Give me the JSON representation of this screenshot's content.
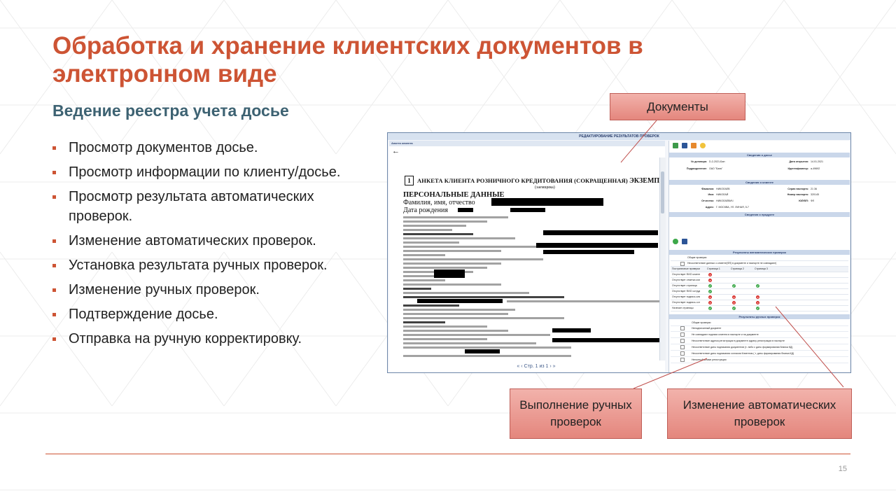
{
  "slide": {
    "title": "Обработка и хранение клиентских документов в электронном виде",
    "subtitle": "Ведение реестра учета досье",
    "bullets": [
      "Просмотр документов досье.",
      "Просмотр информации по клиенту/досье.",
      "Просмотр результата автоматических проверок.",
      "Изменение автоматических проверок.",
      "Установка результата ручных проверок.",
      "Изменение ручных проверок.",
      "Подтверждение досье.",
      "Отправка на ручную корректировку."
    ],
    "page_number": "15",
    "accent_color": "#cd5434"
  },
  "callouts": {
    "documents": "Документы",
    "manual": "Выполнение ручных проверок",
    "auto": "Изменение автоматических проверок"
  },
  "screenshot": {
    "window_title": "РЕДАКТИРОВАНИЕ РЕЗУЛЬТАТОВ ПРОВЕРОК",
    "doc_pane_title": "Анкета клиента",
    "back_icon": "arrow-left-icon",
    "doc": {
      "page_box": "1",
      "heading": "АНКЕТА КЛИЕНТА РОЗНИЧНОГО КРЕДИТОВАНИЯ (СОКРАЩЕННАЯ)",
      "heading_tail": "ЭКЗЕМПЛЯ",
      "subheading": "(заемщика)",
      "section": "ПЕРСОНАЛЬНЫЕ ДАННЫЕ",
      "fio_label": "Фамилия, имя, отчество",
      "birth_label": "Дата рождения"
    },
    "pager": "Стр. 1 из 1",
    "dossier_section": "Сведения о досье",
    "dossier": {
      "contract_label": "№ договора:",
      "contract_value": "D-2-2021-Бан",
      "open_date_label": "Дата открытия:",
      "open_date_value": "14.01.2021",
      "division_label": "Подразделение:",
      "division_value": "ОАО \"Банк\"",
      "id_label": "Идентификатор:",
      "id_value": "a-49692"
    },
    "client_section": "Сведения о клиенте",
    "client": {
      "surname_label": "Фамилия:",
      "surname_value": "НИКОЛАЕВ",
      "name_label": "Имя:",
      "name_value": "НИКОЛАЙ",
      "patronymic_label": "Отчество:",
      "patronymic_value": "НИКОЛАЕВИЧ",
      "passport_series_label": "Серия паспорта:",
      "passport_series_value": "21 36",
      "passport_number_label": "Номер паспорта:",
      "passport_number_value": "320145",
      "type_label": "ЮЛ/ФЛ:",
      "type_value": "ФЛ",
      "address_label": "Адрес:",
      "address_value": "Г. МОСКВА, УЛ. ЛИНАЯ, 5-7"
    },
    "product_section": "Сведения о продукте",
    "auto_section": "Результаты автоматических проверок",
    "auto_general": "Общие проверки",
    "auto_general_row": "Несоответствие данных о клиенте(ФЛ) в документе и паспорте не совпадают)",
    "auto_columns": [
      "Постраничные проверки",
      "Страница 1",
      "Страница 2",
      "Страница 3"
    ],
    "auto_rows": [
      {
        "label": "Отсутствует ФИО клиента",
        "marks": [
          "bad",
          "",
          ""
        ]
      },
      {
        "label": "Отсутствует отметка клиента",
        "marks": [
          "bad",
          "",
          ""
        ]
      },
      {
        "label": "Отсутствует страница",
        "marks": [
          "ok",
          "ok",
          "ok"
        ]
      },
      {
        "label": "Отсутствует ФИО сотрудника",
        "marks": [
          "ok",
          "",
          ""
        ]
      },
      {
        "label": "Отсутствует подпись клиента",
        "marks": [
          "bad",
          "bad",
          "bad"
        ]
      },
      {
        "label": "Отсутствует подпись сотрудника",
        "marks": [
          "bad",
          "bad",
          "bad"
        ]
      },
      {
        "label": "Наличие страницы",
        "marks": [
          "ok",
          "ok",
          "ok"
        ]
      }
    ],
    "manual_section": "Результаты ручных проверок",
    "manual_general": "Общие проверки",
    "manual_rows": [
      "Неподписанный документ",
      "Не совпадают подписи клиента в паспорте и на документе",
      "Несоответствие адреса регистрации в документе адресу регистрации в паспорте",
      "Несоответствие даты подписания документов (т. либо с даты формирования бланка КД)",
      "Несоответствие даты подписания согласия Клиентом ( т. даты формирования бланка КД)",
      "Неполный штамп регистрации"
    ]
  }
}
